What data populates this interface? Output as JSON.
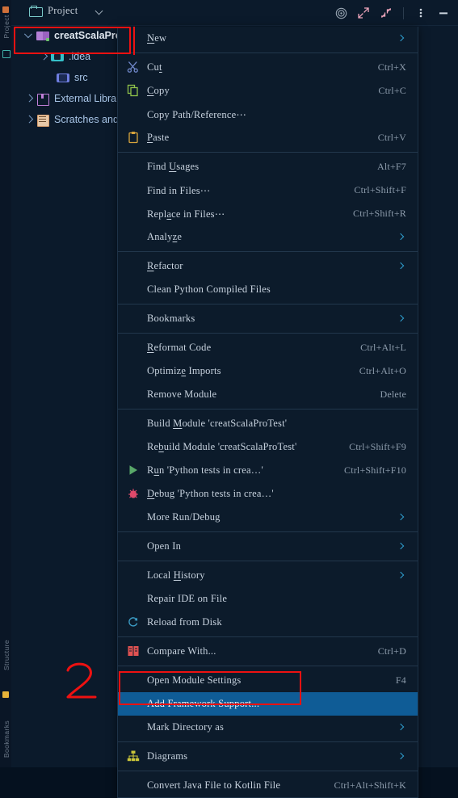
{
  "window": {
    "tool_strip_labels": [
      "Project",
      "Structure",
      "Bookmarks"
    ],
    "panel_title": "Project",
    "toolbar_icons": [
      "target-icon",
      "expand-icon",
      "collapse-icon",
      "more-options-icon",
      "minimize-icon"
    ]
  },
  "tree": [
    {
      "label": "creatScalaProTe",
      "icon": "module-folder-icon",
      "twisty": "down",
      "indent": "root",
      "bold": true
    },
    {
      "label": ".idea",
      "icon": "idea-folder-icon",
      "twisty": "right",
      "indent": "child",
      "bold": false
    },
    {
      "label": "src",
      "icon": "source-folder-icon",
      "twisty": "none",
      "indent": "grand",
      "bold": false
    },
    {
      "label": "External Libraries",
      "icon": "library-icon",
      "twisty": "right",
      "indent": "root",
      "bold": false
    },
    {
      "label": "Scratches and Co",
      "icon": "scratches-icon",
      "twisty": "right",
      "indent": "root",
      "bold": false
    }
  ],
  "menu": {
    "items": [
      {
        "label": "New",
        "accel": "",
        "arrow": true,
        "icon": "",
        "sel": false
      },
      {
        "sep": true
      },
      {
        "label": "Cut",
        "accel": "Ctrl+X",
        "arrow": false,
        "icon": "scissors-icon",
        "sel": false
      },
      {
        "label": "Copy",
        "accel": "Ctrl+C",
        "arrow": false,
        "icon": "copy-icon",
        "sel": false
      },
      {
        "label": "Copy Path/Reference⋯",
        "accel": "",
        "arrow": false,
        "icon": "",
        "sel": false
      },
      {
        "label": "Paste",
        "accel": "Ctrl+V",
        "arrow": false,
        "icon": "clipboard-icon",
        "sel": false
      },
      {
        "sep": true
      },
      {
        "label": "Find Usages",
        "accel": "Alt+F7",
        "arrow": false,
        "icon": "",
        "sel": false
      },
      {
        "label": "Find in Files⋯",
        "accel": "Ctrl+Shift+F",
        "arrow": false,
        "icon": "",
        "sel": false
      },
      {
        "label": "Replace in Files⋯",
        "accel": "Ctrl+Shift+R",
        "arrow": false,
        "icon": "",
        "sel": false
      },
      {
        "label": "Analyze",
        "accel": "",
        "arrow": true,
        "icon": "",
        "sel": false
      },
      {
        "sep": true
      },
      {
        "label": "Refactor",
        "accel": "",
        "arrow": true,
        "icon": "",
        "sel": false
      },
      {
        "label": "Clean Python Compiled Files",
        "accel": "",
        "arrow": false,
        "icon": "",
        "sel": false
      },
      {
        "sep": true
      },
      {
        "label": "Bookmarks",
        "accel": "",
        "arrow": true,
        "icon": "",
        "sel": false
      },
      {
        "sep": true
      },
      {
        "label": "Reformat Code",
        "accel": "Ctrl+Alt+L",
        "arrow": false,
        "icon": "",
        "sel": false
      },
      {
        "label": "Optimize Imports",
        "accel": "Ctrl+Alt+O",
        "arrow": false,
        "icon": "",
        "sel": false
      },
      {
        "label": "Remove Module",
        "accel": "Delete",
        "arrow": false,
        "icon": "",
        "sel": false
      },
      {
        "sep": true
      },
      {
        "label": "Build Module 'creatScalaProTest'",
        "accel": "",
        "arrow": false,
        "icon": "",
        "sel": false
      },
      {
        "label": "Rebuild Module 'creatScalaProTest'",
        "accel": "Ctrl+Shift+F9",
        "arrow": false,
        "icon": "",
        "sel": false
      },
      {
        "label": "Run 'Python tests in crea…'",
        "accel": "Ctrl+Shift+F10",
        "arrow": false,
        "icon": "run-icon",
        "sel": false
      },
      {
        "label": "Debug 'Python tests in crea…'",
        "accel": "",
        "arrow": false,
        "icon": "debug-icon",
        "sel": false
      },
      {
        "label": "More Run/Debug",
        "accel": "",
        "arrow": true,
        "icon": "",
        "sel": false
      },
      {
        "sep": true
      },
      {
        "label": "Open In",
        "accel": "",
        "arrow": true,
        "icon": "",
        "sel": false
      },
      {
        "sep": true
      },
      {
        "label": "Local History",
        "accel": "",
        "arrow": true,
        "icon": "",
        "sel": false
      },
      {
        "label": "Repair IDE on File",
        "accel": "",
        "arrow": false,
        "icon": "",
        "sel": false
      },
      {
        "label": "Reload from Disk",
        "accel": "",
        "arrow": false,
        "icon": "refresh-icon",
        "sel": false
      },
      {
        "sep": true
      },
      {
        "label": "Compare With...",
        "accel": "Ctrl+D",
        "arrow": false,
        "icon": "compare-icon",
        "sel": false
      },
      {
        "sep": true
      },
      {
        "label": "Open Module Settings",
        "accel": "F4",
        "arrow": false,
        "icon": "",
        "sel": false
      },
      {
        "label": "Add Framework Support...",
        "accel": "",
        "arrow": false,
        "icon": "",
        "sel": true
      },
      {
        "label": "Mark Directory as",
        "accel": "",
        "arrow": true,
        "icon": "",
        "sel": false
      },
      {
        "sep": true
      },
      {
        "label": "Diagrams",
        "accel": "",
        "arrow": true,
        "icon": "diagrams-icon",
        "sel": false
      },
      {
        "sep": true
      },
      {
        "label": "Convert Java File to Kotlin File",
        "accel": "Ctrl+Alt+Shift+K",
        "arrow": false,
        "icon": "",
        "sel": false
      }
    ]
  },
  "annotations": {
    "step_number": "2",
    "highlight_color": "#ee1111",
    "selection_color": "#0f5c96"
  }
}
